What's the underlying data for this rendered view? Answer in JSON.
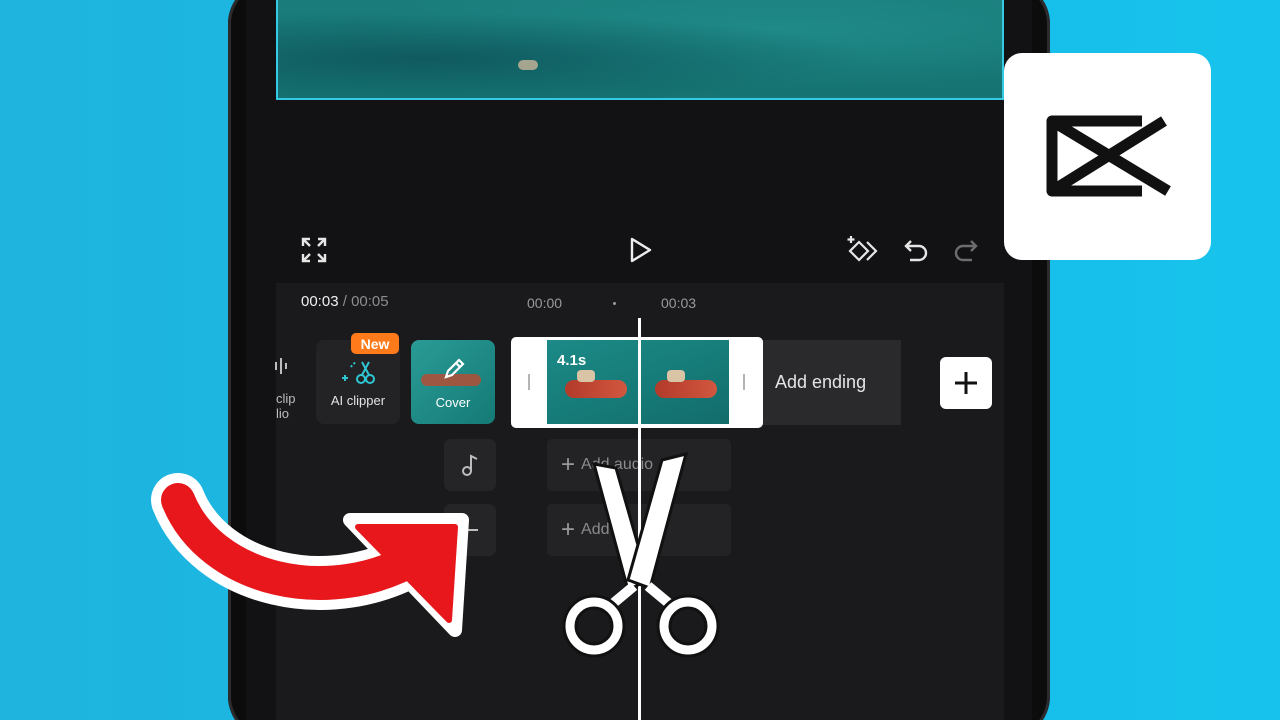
{
  "toolbar": {
    "fullscreen_icon": "expand-icon",
    "play_icon": "play-icon",
    "keyframe_icon": "keyframe-icon",
    "undo_icon": "undo-icon",
    "redo_icon": "redo-icon"
  },
  "timeline": {
    "current_time": "00:03",
    "separator": "/",
    "total_time": "00:05",
    "ruler": [
      "00:00",
      "00:03"
    ],
    "left_partial_labels": [
      "clip",
      "lio"
    ]
  },
  "tools": {
    "ai_clipper_label": "AI clipper",
    "new_badge": "New",
    "cover_label": "Cover"
  },
  "clip": {
    "duration": "4.1s",
    "add_ending_label": "Add ending"
  },
  "tracks": {
    "add_audio_label": "Add audio",
    "second_add_label_partial": "Add"
  },
  "colors": {
    "background": "#17b9e4",
    "accent_badge": "#ff7a1a",
    "arrow": "#e8171c",
    "preview_border": "#35c9e6"
  },
  "logo": {
    "icon": "capcut-logo-icon"
  },
  "overlay": {
    "arrow_icon": "curved-arrow-icon",
    "scissors_icon": "scissors-icon"
  }
}
